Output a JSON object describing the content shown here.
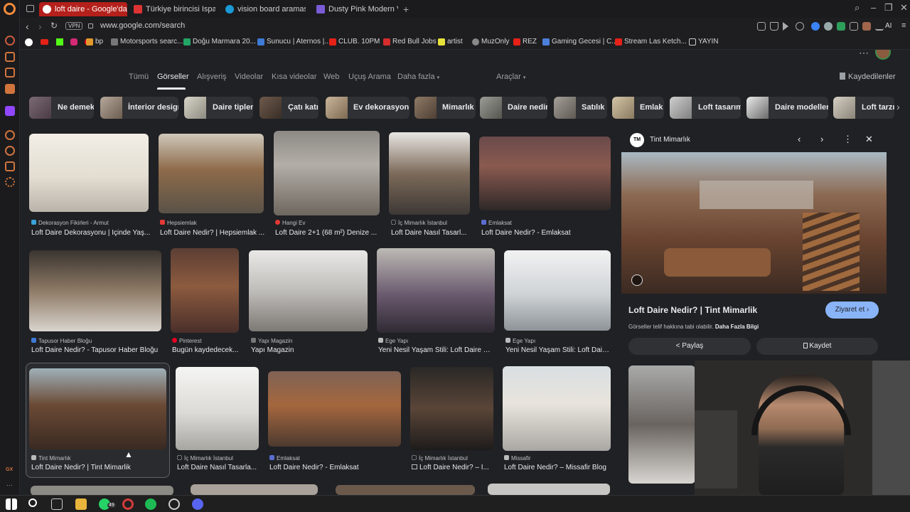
{
  "tabs": [
    {
      "title": "loft daire - Google'da Ara",
      "active": true
    },
    {
      "title": "Türkiye birincisi Isparta'da",
      "active": false
    },
    {
      "title": "vision board araması - Ca",
      "active": false
    },
    {
      "title": "Dusty Pink Modern Vision",
      "active": false
    }
  ],
  "address": {
    "vpn": "VPN",
    "url": "www.google.com/search",
    "ai_label": "AI"
  },
  "bookmarks": [
    "bp",
    "Motorsports searc...",
    "Doğu Marmara 20...",
    "Sunucu | Aternos |...",
    "CLUB. 10PM",
    "Red Bull Jobs",
    "artist",
    "MuzOnly",
    "REZ",
    "Gaming Gecesi | C...",
    "Stream Las Ketch...",
    "YAYIN"
  ],
  "search_nav": {
    "tabs": [
      "Tümü",
      "Görseller",
      "Alışveriş",
      "Videolar",
      "Kısa videolar",
      "Web",
      "Uçuş Arama",
      "Daha fazla",
      "Araçlar"
    ],
    "active": "Görseller",
    "saved": "Kaydedilenler"
  },
  "chips": [
    "Ne demek",
    "İnterior design",
    "Daire tipleri",
    "Çatı katı",
    "Ev dekorasyonu",
    "Mimarlık",
    "Daire nedir",
    "Satılık",
    "Emlak",
    "Loft tasarım",
    "Daire modelleri",
    "Loft tarzı"
  ],
  "results": [
    {
      "source": "Dekorasyon Fikirleri - Armut",
      "title": "Loft Daire Dekorasyonu | İçinde Yaş..."
    },
    {
      "source": "Hepsiemlak",
      "title": "Loft Daire Nedir? | Hepsiemlak ..."
    },
    {
      "source": "Hangi Ev",
      "title": "Loft Daire 2+1 (68 m²) Denize ..."
    },
    {
      "source": "İç Mimarlık İstanbul",
      "title": "Loft Daire Nasıl Tasarl..."
    },
    {
      "source": "Emlaksat",
      "title": "Loft Daire Nedir? - Emlaksat"
    },
    {
      "source": "Tapusor Haber Bloğu",
      "title": "Loft Daire Nedir? - Tapusor Haber Bloğu"
    },
    {
      "source": "Pinterest",
      "title": "Bugün kaydedecek..."
    },
    {
      "source": "Yapı Magazin",
      "title": "Yapı Magazin"
    },
    {
      "source": "Ege Yapı",
      "title": "Yeni Nesil Yaşam Stili: Loft Daire N..."
    },
    {
      "source": "Ege Yapı",
      "title": "Yeni Nesil Yaşam Stili: Loft Dair..."
    },
    {
      "source": "Tint Mimarlık",
      "title": "Loft Daire Nedir? | Tint Mimarlik"
    },
    {
      "source": "İç Mimarlık İstanbul",
      "title": "Loft Daire Nasıl Tasarla..."
    },
    {
      "source": "Emlaksat",
      "title": "Loft Daire Nedir? - Emlaksat"
    },
    {
      "source": "İç Mimarlık İstanbul",
      "title": "Loft Daire Nedir? – İ..."
    },
    {
      "source": "Missafir",
      "title": "Loft Daire Nedir? – Missafir Blog"
    }
  ],
  "preview": {
    "site": "Tint Mimarlık",
    "site_badge": "TM",
    "title": "Loft Daire Nedir? | Tint Mimarlik",
    "visit": "Ziyaret et",
    "copyright": "Görseller telif hakkına tabi olabilir.",
    "more_info": "Daha Fazla Bilgi",
    "share": "Paylaş",
    "save": "Kaydet"
  },
  "taskbar_badge": "49",
  "gx_label": "GX"
}
